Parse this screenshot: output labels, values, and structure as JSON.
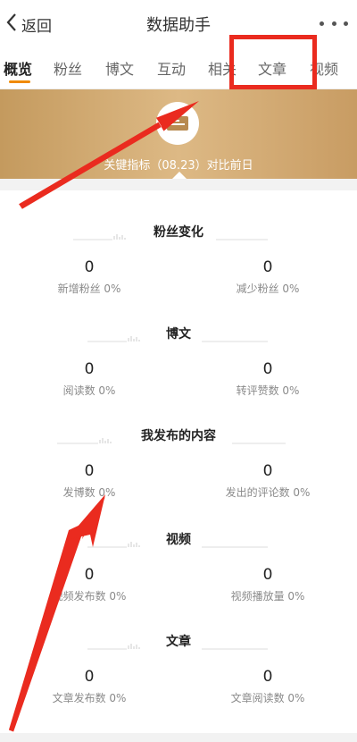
{
  "header": {
    "back_label": "返回",
    "title": "数据助手"
  },
  "tabs": [
    {
      "label": "概览",
      "active": true
    },
    {
      "label": "粉丝",
      "active": false
    },
    {
      "label": "博文",
      "active": false
    },
    {
      "label": "互动",
      "active": false
    },
    {
      "label": "相关",
      "active": false
    },
    {
      "label": "文章",
      "active": false
    },
    {
      "label": "视频",
      "active": false
    }
  ],
  "banner": {
    "text": "关键指标（08.23）对比前日"
  },
  "sections": [
    {
      "title": "粉丝变化",
      "metrics": [
        {
          "value": "0",
          "label": "新增粉丝 0%"
        },
        {
          "value": "0",
          "label": "减少粉丝 0%"
        }
      ]
    },
    {
      "title": "博文",
      "metrics": [
        {
          "value": "0",
          "label": "阅读数 0%"
        },
        {
          "value": "0",
          "label": "转评赞数 0%"
        }
      ]
    },
    {
      "title": "我发布的内容",
      "metrics": [
        {
          "value": "0",
          "label": "发博数 0%"
        },
        {
          "value": "0",
          "label": "发出的评论数 0%"
        }
      ]
    },
    {
      "title": "视频",
      "metrics": [
        {
          "value": "0",
          "label": "视频发布数 0%"
        },
        {
          "value": "0",
          "label": "视频播放量 0%"
        }
      ]
    },
    {
      "title": "文章",
      "metrics": [
        {
          "value": "0",
          "label": "文章发布数 0%"
        },
        {
          "value": "0",
          "label": "文章阅读数 0%"
        }
      ]
    }
  ],
  "colors": {
    "accent": "#f08a00",
    "annotation": "#ea2b1f",
    "banner": "#c9a06a"
  },
  "icons": {
    "back": "chevron-left-icon",
    "more": "ellipsis-icon",
    "banner": "data-card-icon"
  }
}
